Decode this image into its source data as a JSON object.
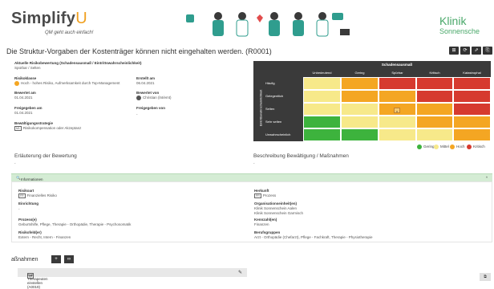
{
  "header": {
    "logo_main": "Simplify",
    "logo_u": "U",
    "tagline": "QM geht auch einfach!",
    "client_line1": "Klinik",
    "client_line2": "Sonnensche"
  },
  "page": {
    "title": "Die Struktur-Vorgaben der Kostenträger können nicht eingehalten werden. (R0001)",
    "toolbar": [
      "⊞",
      "⟳",
      "⇗",
      "⎘"
    ]
  },
  "risk": {
    "assessment_label": "Aktuelle Risikobewertung (Schadensausmaß / Eintrittswahrscheinlichkeit)",
    "assessment_value": "Spürbar / Selten",
    "class_label": "Risikoklasse",
    "class_value": "Hoch - hohes Risiko, Aufmerksamkeit durch Top-Management",
    "created_label": "Erstellt am",
    "created_value": "06.04.2021",
    "rated_label": "Bewertet am",
    "rated_value": "01.04.2021",
    "rated_by_label": "Bewertet von",
    "rated_by_value": "Christian (lnt/emt)",
    "released_label": "Freigegeben am",
    "released_value": "01.04.2021",
    "released_by_label": "Freigegeben von",
    "released_by_value": "-",
    "strategy_label": "Bewältigungsstrategie",
    "strategy_chip": "M1",
    "strategy_value": "Risikokompensation oder Akzeptanz"
  },
  "matrix": {
    "top_title": "Schadensausmaß",
    "side_title": "Eintrittswahrscheinlichkeit",
    "columns": [
      "Unbedeutend",
      "Gering",
      "Spürbar",
      "Kritisch",
      "Katastrophal"
    ],
    "rows": [
      "Häufig",
      "Gelegentlich",
      "Selten",
      "Sehr selten",
      "Unwahrscheinlich"
    ],
    "marker": "x",
    "colors": {
      "green": "#3db33d",
      "yellow": "#f7e98a",
      "orange": "#f4a623",
      "red": "#d63a2f",
      "gray": "#3a3a3a"
    }
  },
  "legend": {
    "items": [
      {
        "label": "Gering",
        "color": "#3db33d"
      },
      {
        "label": "Mittel",
        "color": "#f7e98a"
      },
      {
        "label": "Hoch",
        "color": "#f4a623"
      },
      {
        "label": "Kritisch",
        "color": "#d63a2f"
      }
    ]
  },
  "sections": {
    "explanation_title": "Erläuterung der Bewertung",
    "explanation_value": "-",
    "coping_title": "Beschreibung Bewältigung / Maßnahmen",
    "coping_value": "-"
  },
  "info": {
    "bar_title": "Informationen zum Risiko",
    "risikoart_label": "Risikoart",
    "risikoart_chip": "FR",
    "risikoart_value": "Finanzielles Risiko",
    "herkunft_label": "Herkunft",
    "herkunft_chip": "PR",
    "herkunft_value": "Prozess",
    "einrichtung_label": "Einrichtung",
    "einrichtung_value": "-",
    "org_label": "Organisationseinheit(en)",
    "org_value1": "Klinik Sonnenschein Aalen",
    "org_value2": "Klinik Sonnenschein Garmisch",
    "prozess_label": "Prozess(e)",
    "prozess_value": "Geburtshilfe, Pflege, Therapie - Orthopädie, Therapie - Psychosomatik",
    "kennzahl_label": "Kennzahl(en)",
    "kennzahl_value": "Finanzen",
    "ricklist_label": "Risikofeld(er)",
    "ricklist_value": "Extern - Recht, Intern - Finanzen",
    "berufs_label": "Berufsgruppen",
    "berufs_value": "Arzt - Orthopädie (Chefarzt), Pflege - Fachkraft, Therapie - Physiotherapie"
  },
  "measures": {
    "title": "aßnahmen",
    "add_label": "+",
    "link_label": "∞",
    "row_chip": "M",
    "row_text": "eue Therapeuten einstellen (A0019)",
    "row_icon": "✎"
  },
  "sticky_label": "⧉"
}
